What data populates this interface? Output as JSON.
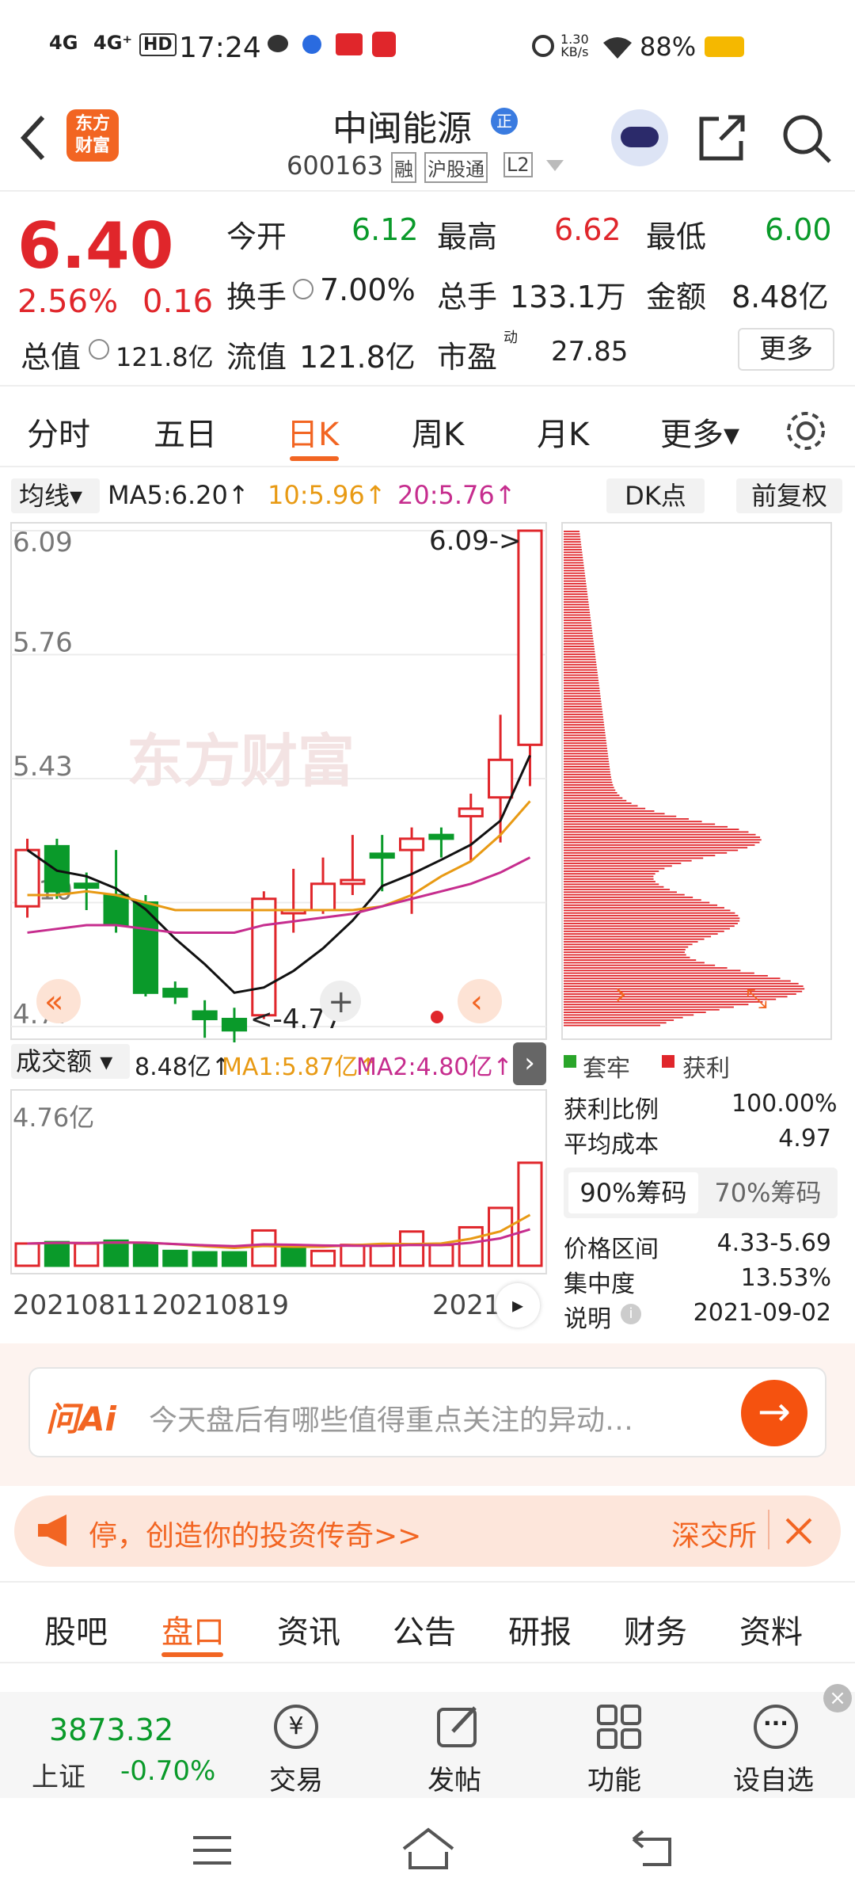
{
  "status": {
    "network1": "4G",
    "network2": "4G⁺",
    "hd": "HD",
    "time": "17:24",
    "speed_top": "1.30",
    "speed_unit": "KB/s",
    "battery": "88%"
  },
  "header": {
    "logo_line1": "东方",
    "logo_line2": "财富",
    "stock_name": "中闽能源",
    "badge": "正",
    "code": "600163",
    "tags": [
      "融",
      "沪股通",
      "L2"
    ]
  },
  "quote": {
    "price": "6.40",
    "change_pct": "2.56%",
    "change": "0.16",
    "open_label": "今开",
    "open": "6.12",
    "high_label": "最高",
    "high": "6.62",
    "low_label": "最低",
    "low": "6.00",
    "turnover_label": "换手",
    "turnover": "7.00%",
    "volume_label": "总手",
    "volume": "133.1万",
    "amount_label": "金额",
    "amount": "8.48亿",
    "mcap_label": "总值",
    "mcap": "121.8亿",
    "float_label": "流值",
    "float": "121.8亿",
    "pe_label": "市盈",
    "pe_sup": "动",
    "pe": "27.85",
    "more": "更多"
  },
  "tabs": [
    {
      "label": "分时"
    },
    {
      "label": "五日"
    },
    {
      "label": "日K",
      "active": true
    },
    {
      "label": "周K"
    },
    {
      "label": "月K"
    },
    {
      "label": "更多▾"
    }
  ],
  "ma": {
    "type": "均线",
    "ma5": "MA5:6.20↑",
    "ma10": "10:5.96↑",
    "ma20": "20:5.76↑",
    "dk": "DK点",
    "fq": "前复权"
  },
  "kline": {
    "yticks": [
      "6.09",
      "5.76",
      "5.43",
      "5.10",
      "4.77"
    ],
    "hi_label": "6.09->",
    "lo_label": "<-4.77",
    "watermark": "东方财富"
  },
  "vol": {
    "type": "成交额",
    "val": "8.48亿↑",
    "ma1": "MA1:5.87亿↑",
    "ma2": "MA2:4.80亿↑",
    "max": "4.76亿",
    "dates": [
      "20210811",
      "20210819",
      "2021"
    ]
  },
  "chip": {
    "legend_trap": "套牢",
    "legend_profit": "获利",
    "profit_ratio_label": "获利比例",
    "profit_ratio": "100.00%",
    "avg_cost_label": "平均成本",
    "avg_cost": "4.97",
    "tab90": "90%筹码",
    "tab70": "70%筹码",
    "range_label": "价格区间",
    "range": "4.33-5.69",
    "conc_label": "集中度",
    "conc": "13.53%",
    "note_label": "说明",
    "note_date": "2021-09-02"
  },
  "ai": {
    "logo": "问Ai",
    "placeholder": "今天盘后有哪些值得重点关注的异动…"
  },
  "banner": {
    "text": "停，创造你的投资传奇>>",
    "right": "深交所"
  },
  "navtabs": [
    {
      "label": "股吧"
    },
    {
      "label": "盘口",
      "active": true
    },
    {
      "label": "资讯"
    },
    {
      "label": "公告"
    },
    {
      "label": "研报"
    },
    {
      "label": "财务"
    },
    {
      "label": "资料"
    }
  ],
  "bottom": {
    "index_val": "3873.32",
    "index_name": "上证",
    "index_chg": "-0.70%",
    "trade": "交易",
    "post": "发帖",
    "func": "功能",
    "watch": "设自选"
  },
  "colors": {
    "red": "#e0262b",
    "green": "#0a9a2a",
    "orange": "#ff6a00"
  },
  "chart_data": [
    {
      "type": "candlestick",
      "title": "",
      "ylim": [
        4.77,
        6.09
      ],
      "ma_lines": [
        {
          "name": "MA5",
          "value": 6.2
        },
        {
          "name": "MA10",
          "value": 5.96
        },
        {
          "name": "MA20",
          "value": 5.76
        }
      ],
      "candles": [
        {
          "o": 5.09,
          "c": 5.24,
          "h": 5.27,
          "l": 5.06
        },
        {
          "o": 5.25,
          "c": 5.13,
          "h": 5.27,
          "l": 5.11
        },
        {
          "o": 5.15,
          "c": 5.14,
          "h": 5.18,
          "l": 5.08
        },
        {
          "o": 5.12,
          "c": 5.04,
          "h": 5.24,
          "l": 5.02
        },
        {
          "o": 5.1,
          "c": 4.86,
          "h": 5.12,
          "l": 4.85
        },
        {
          "o": 4.87,
          "c": 4.85,
          "h": 4.89,
          "l": 4.83
        },
        {
          "o": 4.81,
          "c": 4.79,
          "h": 4.84,
          "l": 4.74
        },
        {
          "o": 4.79,
          "c": 4.76,
          "h": 4.82,
          "l": 4.72
        },
        {
          "o": 4.8,
          "c": 5.11,
          "h": 5.13,
          "l": 4.79
        },
        {
          "o": 5.08,
          "c": 5.08,
          "h": 5.19,
          "l": 5.02
        },
        {
          "o": 5.08,
          "c": 5.15,
          "h": 5.22,
          "l": 5.07
        },
        {
          "o": 5.15,
          "c": 5.16,
          "h": 5.28,
          "l": 5.12
        },
        {
          "o": 5.23,
          "c": 5.22,
          "h": 5.28,
          "l": 5.13
        },
        {
          "o": 5.24,
          "c": 5.27,
          "h": 5.3,
          "l": 5.07
        },
        {
          "o": 5.28,
          "c": 5.27,
          "h": 5.3,
          "l": 5.22
        },
        {
          "o": 5.33,
          "c": 5.35,
          "h": 5.39,
          "l": 5.21
        },
        {
          "o": 5.38,
          "c": 5.48,
          "h": 5.6,
          "l": 5.26
        },
        {
          "o": 5.52,
          "c": 6.09,
          "h": 6.09,
          "l": 5.41
        }
      ]
    },
    {
      "type": "bar",
      "title": "",
      "ylim": [
        0,
        4.76
      ],
      "unit": "亿",
      "values": [
        0.63,
        0.67,
        0.63,
        0.71,
        0.63,
        0.42,
        0.38,
        0.38,
        1.0,
        0.51,
        0.42,
        0.59,
        0.59,
        0.97,
        0.59,
        1.09,
        1.64,
        2.92
      ],
      "up": [
        1,
        0,
        1,
        0,
        0,
        0,
        0,
        0,
        1,
        0,
        1,
        1,
        1,
        1,
        1,
        1,
        1,
        1
      ]
    }
  ]
}
